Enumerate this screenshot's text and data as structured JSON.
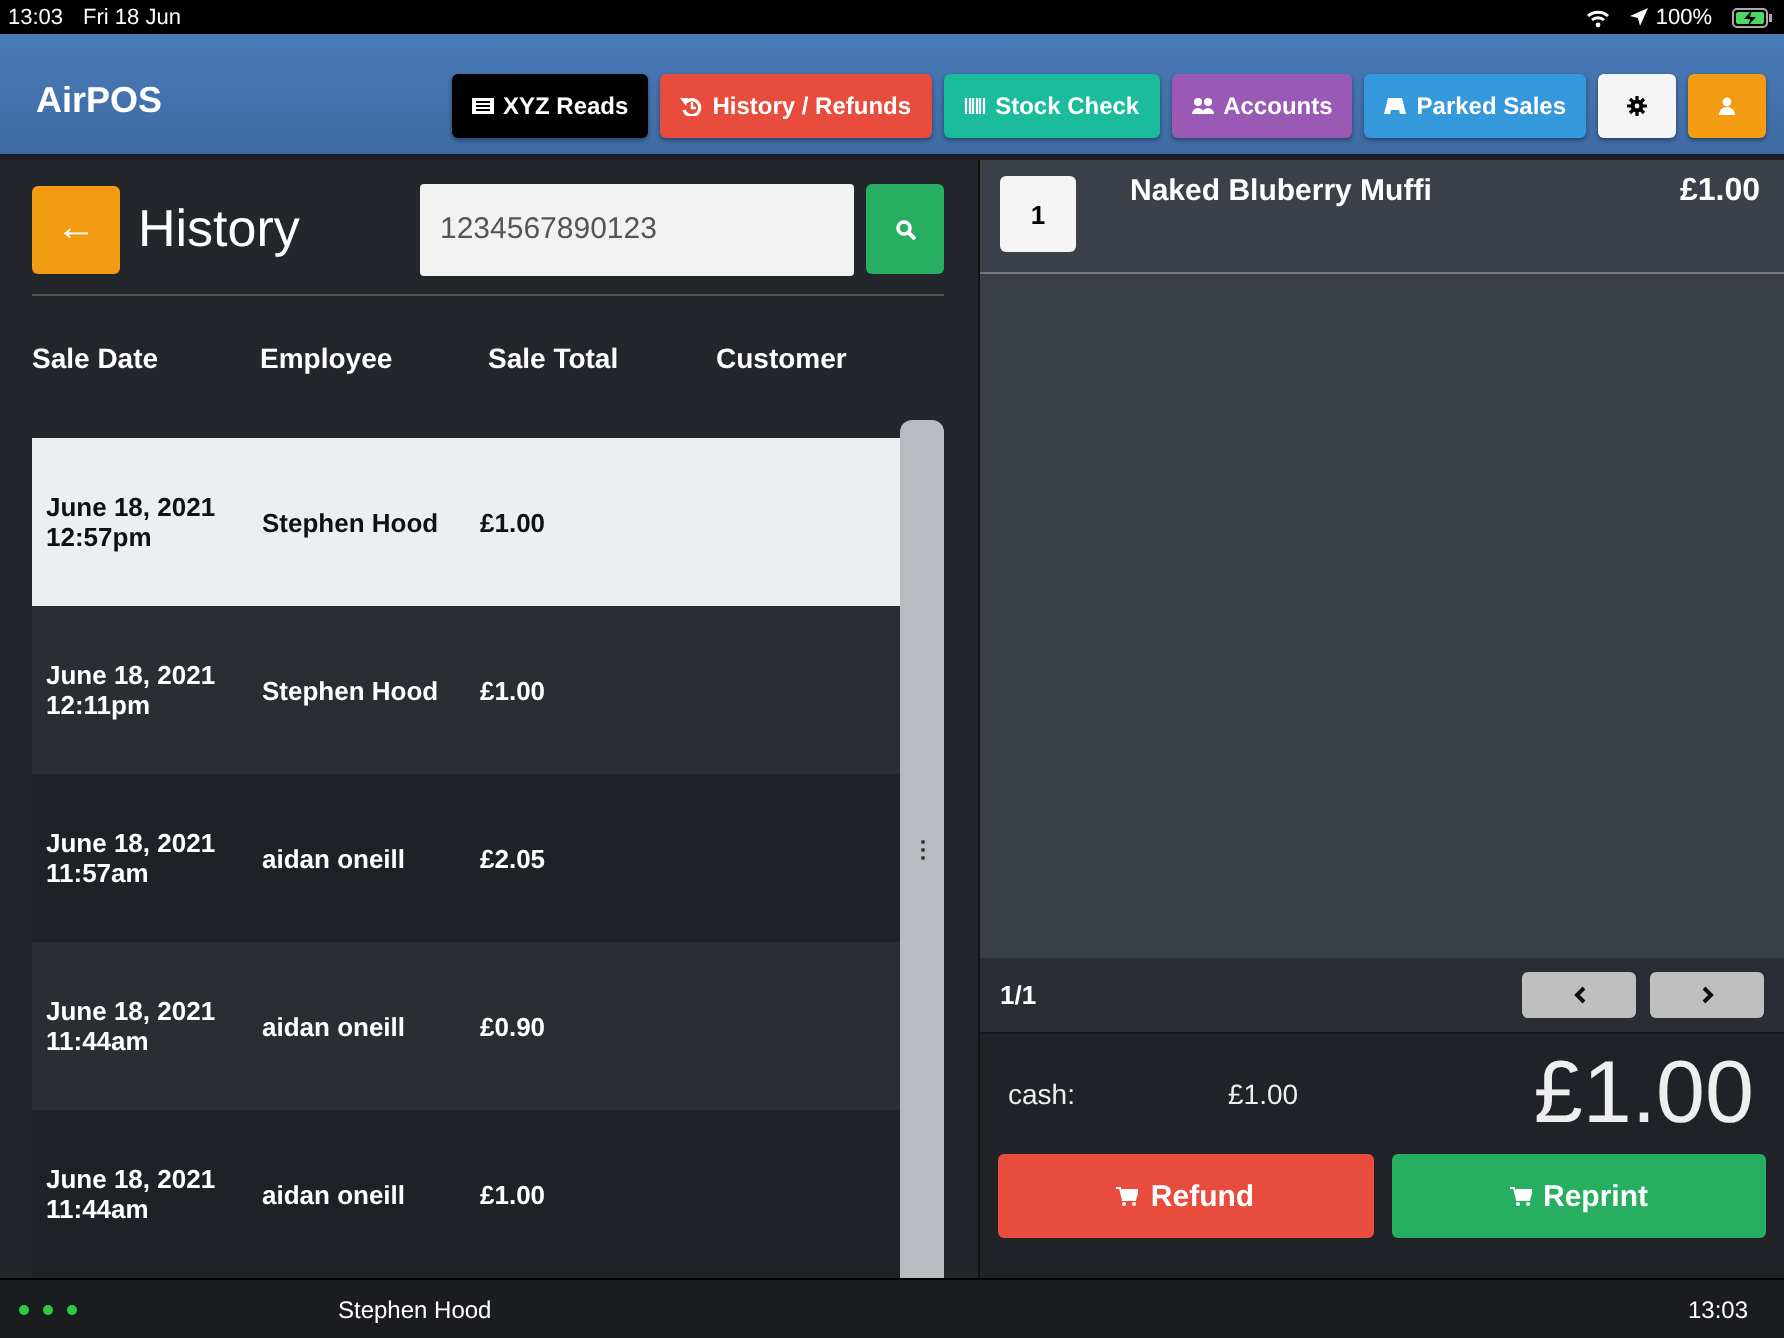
{
  "status_bar": {
    "time": "13:03",
    "date": "Fri 18 Jun",
    "battery": "100%"
  },
  "header": {
    "title": "AirPOS",
    "nav": [
      {
        "kind": "reads",
        "label": "XYZ Reads",
        "color": "#000000"
      },
      {
        "kind": "history",
        "label": "History / Refunds",
        "color": "#e74c3c"
      },
      {
        "kind": "stock",
        "label": "Stock Check",
        "color": "#1abc9c"
      },
      {
        "kind": "accounts",
        "label": "Accounts",
        "color": "#9b59b6"
      },
      {
        "kind": "parked",
        "label": "Parked Sales",
        "color": "#3498db"
      },
      {
        "kind": "settings",
        "color": "#f5f5f5"
      },
      {
        "kind": "user",
        "color": "#f39c12"
      }
    ]
  },
  "history": {
    "back": "←",
    "title": "History",
    "search": {
      "value": "1234567890123"
    },
    "columns": [
      "Sale Date",
      "Employee",
      "Sale Total",
      "Customer"
    ],
    "rows": [
      {
        "date": "June 18, 2021",
        "time": "12:57pm",
        "employee": "Stephen Hood",
        "total": "£1.00",
        "selected": true
      },
      {
        "date": "June 18, 2021",
        "time": "12:11pm",
        "employee": "Stephen Hood",
        "total": "£1.00",
        "selected": false
      },
      {
        "date": "June 18, 2021",
        "time": "11:57am",
        "employee": "aidan oneill",
        "total": "£2.05",
        "selected": false
      },
      {
        "date": "June 18, 2021",
        "time": "11:44am",
        "employee": "aidan oneill",
        "total": "£0.90",
        "selected": false
      },
      {
        "date": "June 18, 2021",
        "time": "11:44am",
        "employee": "aidan oneill",
        "total": "£1.00",
        "selected": false
      }
    ]
  },
  "sale": {
    "items": [
      {
        "qty": "1",
        "name": "Naked Bluberry Muffi",
        "price": "£1.00"
      }
    ],
    "page": "1/1",
    "payment_label": "cash:",
    "payment_amount": "£1.00",
    "total": "£1.00",
    "actions": [
      {
        "label": "Refund",
        "color": "#e74c3c"
      },
      {
        "label": "Reprint",
        "color": "#27ae60"
      }
    ]
  },
  "footer": {
    "user": "Stephen Hood",
    "time": "13:03"
  }
}
